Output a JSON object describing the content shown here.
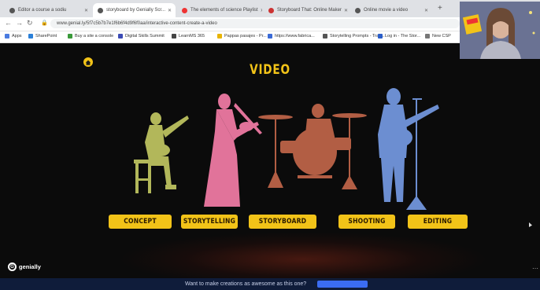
{
  "browser": {
    "tabs": [
      {
        "label": "Editor a course a sodiu",
        "active": false
      },
      {
        "label": "storyboard by Genially Scr...",
        "active": true
      },
      {
        "label": "The elements of science Playlist",
        "active": false
      },
      {
        "label": "Storyboard That: Online Maker",
        "active": false
      },
      {
        "label": "Online movie a video",
        "active": false
      }
    ],
    "url": "www.genial.ly/5f7c5b7b7e1f6b6f4d9f6f0aa/interactive-content-create-a-video",
    "bookmarks": [
      "Apps",
      "SharePoint",
      "Buy a site a console",
      "Digital Skills Summit",
      "LearnMS 365",
      "Pappas pasajes - Pr...",
      "https://www.fabrica...",
      "Storytelling Prompts - Tran...",
      "Log in - The Stor...",
      "New CSP"
    ]
  },
  "content": {
    "title": "VIDEO",
    "menu": [
      "CONCEPT",
      "STORYTELLING",
      "STORYBOARD",
      "SHOOTING",
      "EDITING"
    ],
    "brand": "genially",
    "footer_text": "Want to make creations as awesome as this one?"
  },
  "colors": {
    "accent": "#f2c318",
    "guitarist": "#b2b75a",
    "violinist": "#e1739a",
    "drummer": "#b25e44",
    "singer": "#6c8ed1"
  }
}
